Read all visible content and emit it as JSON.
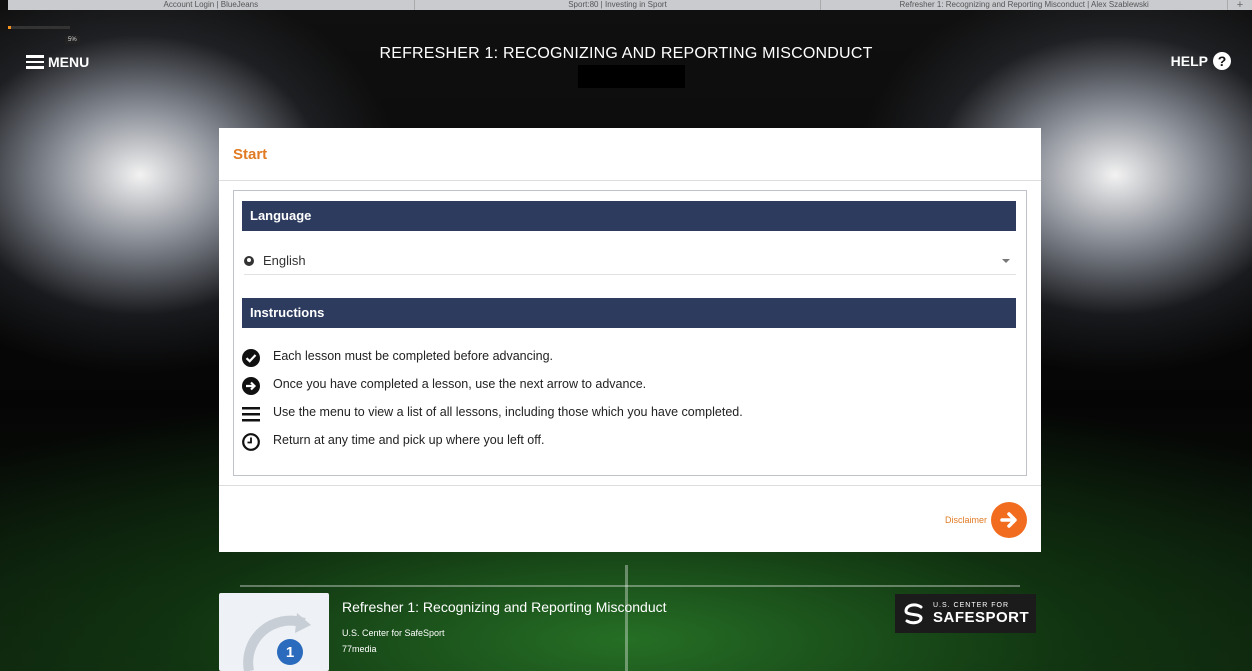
{
  "browser": {
    "tabs": [
      "Account Login | BlueJeans",
      "Sport:80 | Investing in Sport",
      "Refresher 1: Recognizing and Reporting Misconduct | Alex Szablewski"
    ],
    "new_tab_symbol": "+"
  },
  "progress": {
    "percent_label": "5%",
    "fraction": 0.05
  },
  "header": {
    "menu_label": "MENU",
    "title": "REFRESHER 1: RECOGNIZING AND REPORTING MISCONDUCT",
    "help_label": "HELP",
    "help_icon_symbol": "?"
  },
  "card": {
    "title": "Start",
    "language_heading": "Language",
    "language_value": "English",
    "instructions_heading": "Instructions",
    "instructions": [
      {
        "icon": "check-circle-icon",
        "text": "Each lesson must be completed before advancing."
      },
      {
        "icon": "arrow-circle-icon",
        "text": "Once you have completed a lesson, use the next arrow to advance."
      },
      {
        "icon": "list-icon",
        "text": "Use the menu to view a list of all lessons, including those which you have completed."
      },
      {
        "icon": "clock-icon",
        "text": "Return at any time and pick up where you left off."
      }
    ],
    "next_label": "Disclaimer"
  },
  "course_info": {
    "title": "Refresher 1: Recognizing and Reporting Misconduct",
    "organization": "U.S. Center for SafeSport",
    "author": "77media",
    "badge_number": "1"
  },
  "logo": {
    "small_text": "U.S. CENTER FOR",
    "big_text": "SAFESPORT"
  },
  "colors": {
    "accent": "#f26c1f",
    "title_orange": "#e07b24",
    "section_bar": "#2d3b5e"
  }
}
